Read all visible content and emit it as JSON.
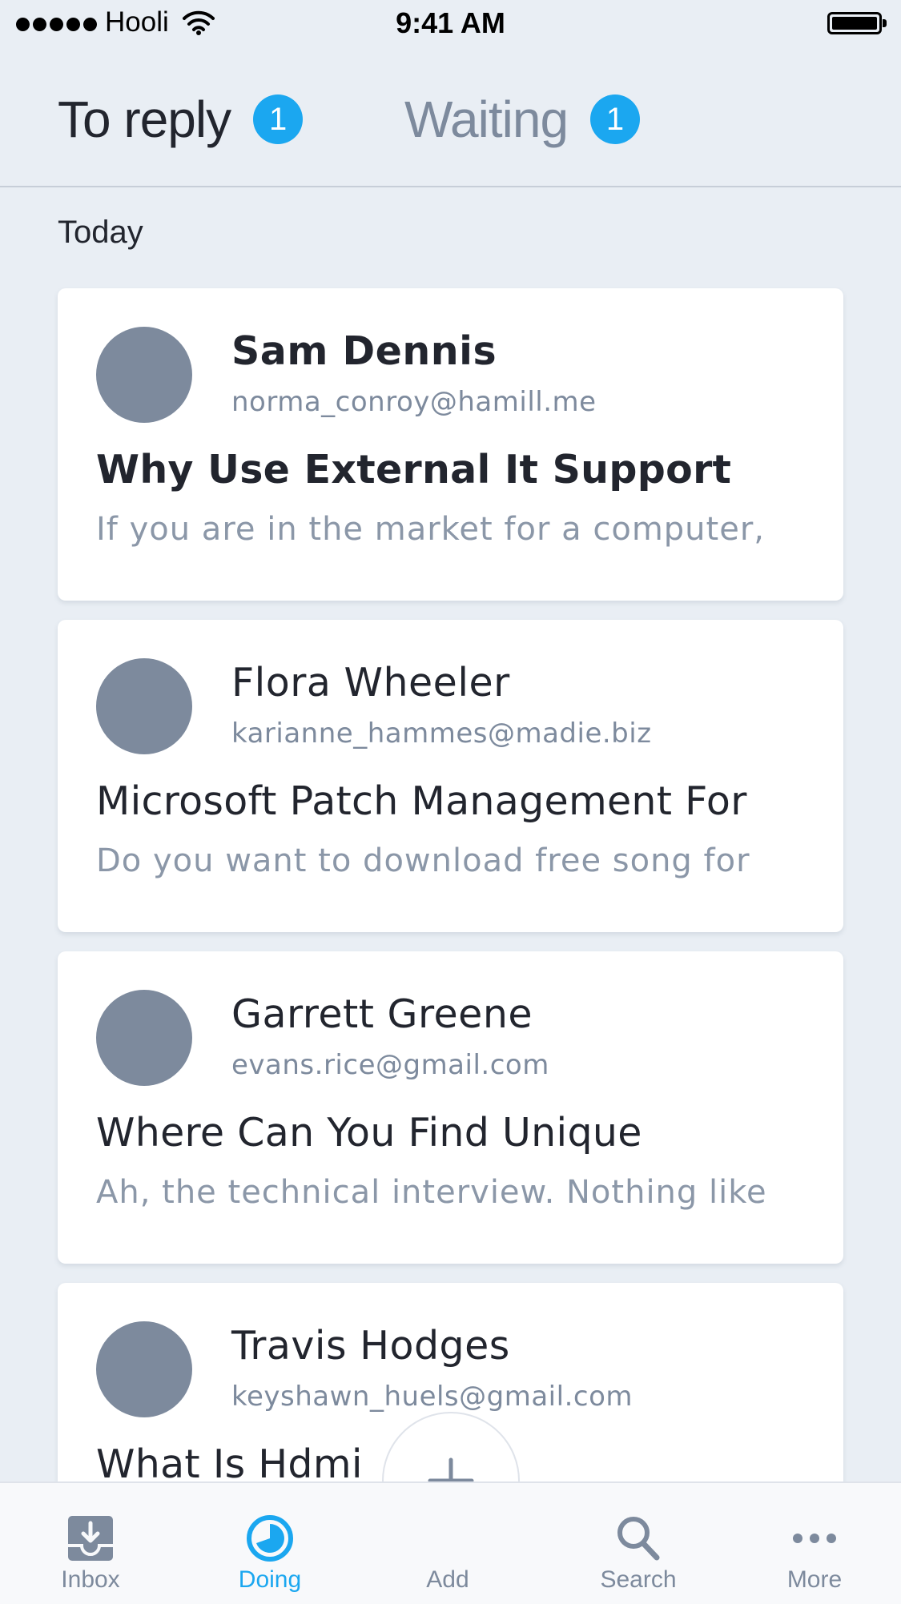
{
  "status_bar": {
    "carrier": "Hooli",
    "time": "9:41 AM"
  },
  "tabs": [
    {
      "label": "To reply",
      "count": "1",
      "active": true
    },
    {
      "label": "Waiting",
      "count": "1",
      "active": false
    }
  ],
  "section": {
    "title": "Today"
  },
  "messages": [
    {
      "sender": "Sam Dennis",
      "email": "norma_conroy@hamill.me",
      "subject": "Why Use External It Support",
      "preview": "If you are in the market for a computer,",
      "unread": true
    },
    {
      "sender": "Flora Wheeler",
      "email": "karianne_hammes@madie.biz",
      "subject": "Microsoft Patch Management For",
      "preview": "Do you want to download free song for",
      "unread": false
    },
    {
      "sender": "Garrett Greene",
      "email": "evans.rice@gmail.com",
      "subject": "Where Can You Find Unique",
      "preview": "Ah, the technical interview. Nothing like",
      "unread": false
    },
    {
      "sender": "Travis Hodges",
      "email": "keyshawn_huels@gmail.com",
      "subject": "What Is Hdmi",
      "preview": "",
      "unread": false
    }
  ],
  "tab_bar": {
    "items": [
      {
        "label": "Inbox",
        "icon": "inbox-icon"
      },
      {
        "label": "Doing",
        "icon": "doing-icon",
        "active": true
      },
      {
        "label": "Add",
        "icon": "plus-icon"
      },
      {
        "label": "Search",
        "icon": "search-icon"
      },
      {
        "label": "More",
        "icon": "more-icon"
      }
    ]
  },
  "colors": {
    "accent": "#1ba7f0",
    "background": "#e9eef4",
    "avatar": "#7d8a9d",
    "text": "#22252e"
  }
}
